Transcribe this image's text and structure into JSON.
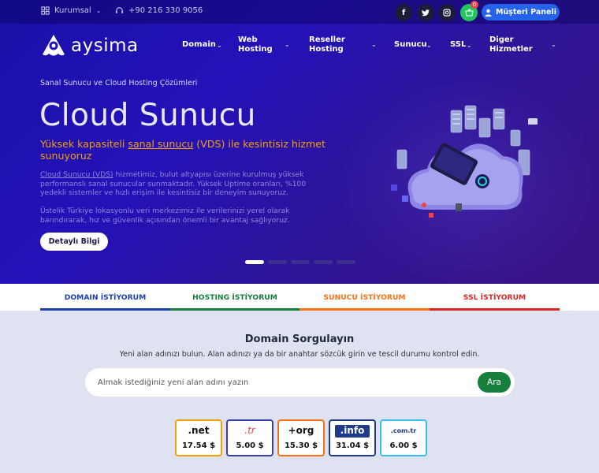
{
  "topbar": {
    "corporate_label": "Kurumsal",
    "phone": "+90 216 330 9056",
    "social": [
      {
        "icon": "facebook-icon",
        "glyph": "f"
      },
      {
        "icon": "twitter-icon",
        "glyph": "t"
      },
      {
        "icon": "instagram-icon",
        "glyph": "◎"
      }
    ],
    "cart_count": "0",
    "customer_panel_label": "Müşteri Paneli"
  },
  "nav": {
    "logo_text": "aysima",
    "items": [
      {
        "line1": "Domain",
        "line2": ""
      },
      {
        "line1": "Web",
        "line2": "Hosting"
      },
      {
        "line1": "Reseller",
        "line2": "Hosting"
      },
      {
        "line1": "Sunucu",
        "line2": ""
      },
      {
        "line1": "SSL",
        "line2": ""
      },
      {
        "line1": "Diger",
        "line2": "Hizmetler"
      }
    ]
  },
  "hero": {
    "subtitle": "Sanal Sunucu ve Cloud Hosting Çözümleri",
    "title": "Cloud Sunucu",
    "lead_before": "Yüksek kapasiteli ",
    "lead_link": "sanal sunucu",
    "lead_after": " (VDS) ile kesintisiz hizmet sunuyoruz",
    "p1_link": "Cloud Sunucu (VDS)",
    "p1_rest": " hizmetimiz, bulut altyapısı üzerine kurulmuş yüksek performanslı sanal sunucular sunmaktadır. Yüksek Uptime oranları, %100 yedekli sistemler ve hızlı erişim ile kesintisiz bir deneyim sunuyoruz.",
    "p2": "Üstelik Türkiye lokasyonlu veri merkezimiz ile verilerinizi yerel olarak barındırarak, hız ve güvenlik açısından önemli bir avantaj sağlıyoruz.",
    "cta_label": "Detaylı Bilgi",
    "slides": 5,
    "active_slide": 1
  },
  "tabs": [
    {
      "label": "DOMAIN İSTİYORUM",
      "color": "#1e40af"
    },
    {
      "label": "HOSTING İSTİYORUM",
      "color": "#15803d"
    },
    {
      "label": "SUNUCU İSTİYORUM",
      "color": "#f97316"
    },
    {
      "label": "SSL İSTİYORUM",
      "color": "#dc2626"
    }
  ],
  "domain_search": {
    "title": "Domain Sorgulayın",
    "subtitle": "Yeni alan adınızı bulun. Alan adınızı ya da bir anahtar sözcük girin ve tescil durumu kontrol edin.",
    "placeholder": "Almak istediğiniz yeni alan adını yazın",
    "button_label": "Ara"
  },
  "tlds": [
    {
      "name": ".net",
      "price": "17.54 $",
      "border": "#f59e0b"
    },
    {
      "name": ".tr",
      "price": "5.00 $",
      "border": "#3b3fae"
    },
    {
      "name": "+org",
      "price": "15.30 $",
      "border": "#f97316"
    },
    {
      "name": ".info",
      "price": "31.04 $",
      "border": "#1e3a8a"
    },
    {
      "name": ".com.tr",
      "price": "6.00 $",
      "border": "#38bdf8"
    }
  ],
  "colors": {
    "hero_bg": "#2412b8",
    "accent_orange": "#f59e0b",
    "panel_blue": "#2563eb",
    "search_green": "#15803d"
  }
}
